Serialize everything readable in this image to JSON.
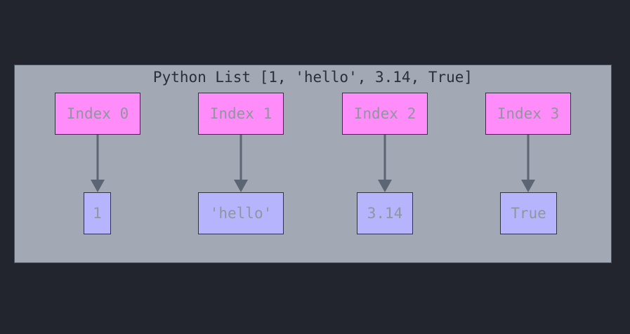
{
  "diagram": {
    "title": "Python List [1, 'hello', 3.14, True]",
    "colors": {
      "background": "#22252d",
      "container": "#a2a8b4",
      "index_fill": "#ff8cf8",
      "value_fill": "#b5b4fc",
      "arrow": "#5b6574"
    },
    "indices": [
      {
        "label": "Index 0"
      },
      {
        "label": "Index 1"
      },
      {
        "label": "Index 2"
      },
      {
        "label": "Index 3"
      }
    ],
    "values": [
      {
        "label": "1"
      },
      {
        "label": "'hello'"
      },
      {
        "label": "3.14"
      },
      {
        "label": "True"
      }
    ],
    "edges": [
      {
        "from": "Index 0",
        "to": "1"
      },
      {
        "from": "Index 1",
        "to": "'hello'"
      },
      {
        "from": "Index 2",
        "to": "3.14"
      },
      {
        "from": "Index 3",
        "to": "True"
      }
    ]
  }
}
